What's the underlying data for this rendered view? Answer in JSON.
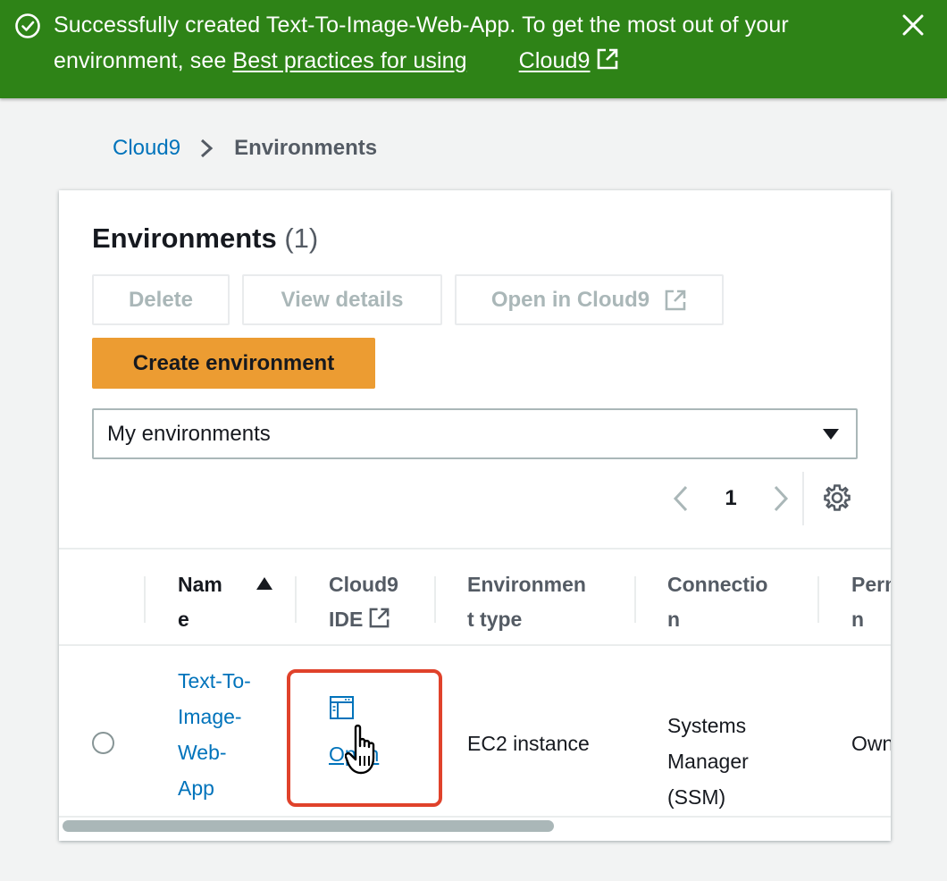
{
  "flash": {
    "message": "Successfully created Text-To-Image-Web-App. To get the most out of your environment, see ",
    "link_text": "Best practices for using",
    "link2_text": "Cloud9",
    "status_color": "#2e8317"
  },
  "breadcrumb": {
    "items": [
      "Cloud9",
      "Environments"
    ]
  },
  "panel": {
    "title": "Environments",
    "count": "(1)",
    "buttons": {
      "delete": "Delete",
      "view_details": "View details",
      "open_in_cloud9": "Open in Cloud9",
      "create": "Create environment"
    },
    "filter": {
      "selected": "My environments"
    },
    "pagination": {
      "current_page": "1"
    }
  },
  "table": {
    "headers": {
      "name_l1": "Nam",
      "name_l2": "e",
      "ide_l1": "Cloud9",
      "ide_l2": "IDE",
      "env_type_l1": "Environmen",
      "env_type_l2": "t type",
      "connection_l1": "Connectio",
      "connection_l2": "n",
      "permission_l1": "Permission",
      "permission_l2": "n"
    },
    "rows": [
      {
        "name_lines": [
          "Text-To-",
          "Image-",
          "Web-",
          "App"
        ],
        "ide_link": "Open",
        "env_type": "EC2 instance",
        "connection_lines": [
          "Systems",
          "Manager",
          "(SSM)"
        ],
        "permission": "Owner"
      }
    ]
  },
  "colors": {
    "link": "#0073bb",
    "primary_button": "#ec9c32",
    "highlight_box": "#e0422b"
  }
}
